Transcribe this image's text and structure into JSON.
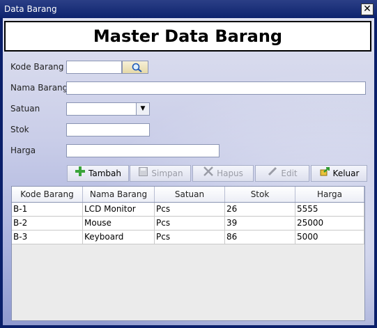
{
  "window": {
    "title": "Data Barang",
    "close_label": "✕"
  },
  "header": {
    "title": "Master Data Barang"
  },
  "form": {
    "kode": {
      "label": "Kode Barang",
      "value": ""
    },
    "nama": {
      "label": "Nama Barang",
      "value": ""
    },
    "satuan": {
      "label": "Satuan",
      "value": ""
    },
    "stok": {
      "label": "Stok",
      "value": ""
    },
    "harga": {
      "label": "Harga",
      "value": ""
    }
  },
  "buttons": {
    "tambah": "Tambah",
    "simpan": "Simpan",
    "hapus": "Hapus",
    "edit": "Edit",
    "keluar": "Keluar"
  },
  "icons": {
    "search": "search-icon",
    "add": "plus-icon",
    "save": "floppy-icon",
    "delete": "x-icon",
    "edit": "pencil-icon",
    "exit": "exit-icon"
  },
  "table": {
    "columns": [
      "Kode Barang",
      "Nama Barang",
      "Satuan",
      "Stok",
      "Harga"
    ],
    "rows": [
      [
        "B-1",
        "LCD Monitor",
        "Pcs",
        "26",
        "5555"
      ],
      [
        "B-2",
        "Mouse",
        "Pcs",
        "39",
        "25000"
      ],
      [
        "B-3",
        "Keyboard",
        "Pcs",
        "86",
        "5000"
      ]
    ]
  },
  "colors": {
    "titlebar": "#0d236e",
    "accent_add": "#2e9a2e"
  }
}
